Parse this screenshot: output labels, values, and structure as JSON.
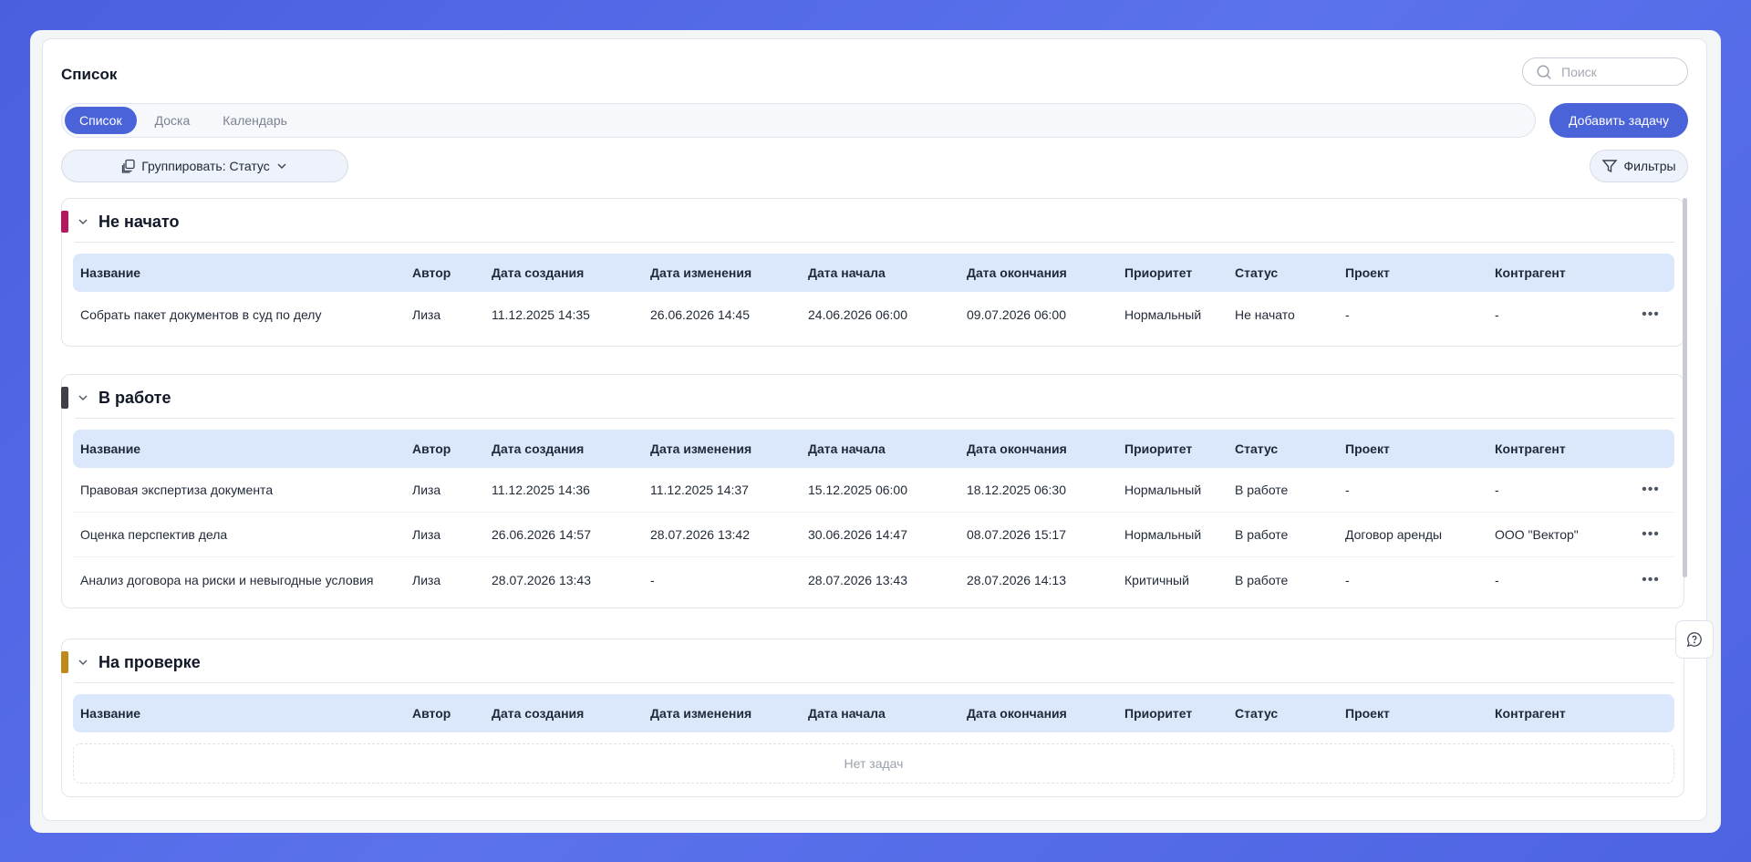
{
  "header": {
    "title": "Список",
    "search_placeholder": "Поиск"
  },
  "tabs": [
    {
      "label": "Список",
      "active": true
    },
    {
      "label": "Доска",
      "active": false
    },
    {
      "label": "Календарь",
      "active": false
    }
  ],
  "toolbar": {
    "add_task_label": "Добавить задачу",
    "group_label": "Группировать: Статус",
    "filters_label": "Фильтры"
  },
  "columns": [
    "Название",
    "Автор",
    "Дата создания",
    "Дата изменения",
    "Дата начала",
    "Дата окончания",
    "Приоритет",
    "Статус",
    "Проект",
    "Контрагент"
  ],
  "groups": [
    {
      "title": "Не начато",
      "color": "#b5175f",
      "rows": [
        [
          "Собрать пакет документов в суд по делу",
          "Лиза",
          "11.12.2025 14:35",
          "26.06.2026 14:45",
          "24.06.2026 06:00",
          "09.07.2026 06:00",
          "Нормальный",
          "Не начато",
          "-",
          "-"
        ]
      ]
    },
    {
      "title": "В работе",
      "color": "#3f4046",
      "rows": [
        [
          "Правовая экспертиза документа",
          "Лиза",
          "11.12.2025 14:36",
          "11.12.2025 14:37",
          "15.12.2025 06:00",
          "18.12.2025 06:30",
          "Нормальный",
          "В работе",
          "-",
          "-"
        ],
        [
          "Оценка перспектив дела",
          "Лиза",
          "26.06.2026 14:57",
          "28.07.2026 13:42",
          "30.06.2026 14:47",
          "08.07.2026 15:17",
          "Нормальный",
          "В работе",
          "Договор аренды",
          "ООО \"Вектор\""
        ],
        [
          "Анализ договора на риски и невыгодные условия",
          "Лиза",
          "28.07.2026 13:43",
          "-",
          "28.07.2026 13:43",
          "28.07.2026 14:13",
          "Критичный",
          "В работе",
          "-",
          "-"
        ]
      ]
    },
    {
      "title": "На проверке",
      "color": "#c08a1a",
      "rows": [],
      "empty_text": "Нет задач"
    }
  ],
  "more_icon": "more-horizontal-icon",
  "colors": {
    "accent": "#4a63d8",
    "header_bg": "#dbe8fc"
  }
}
